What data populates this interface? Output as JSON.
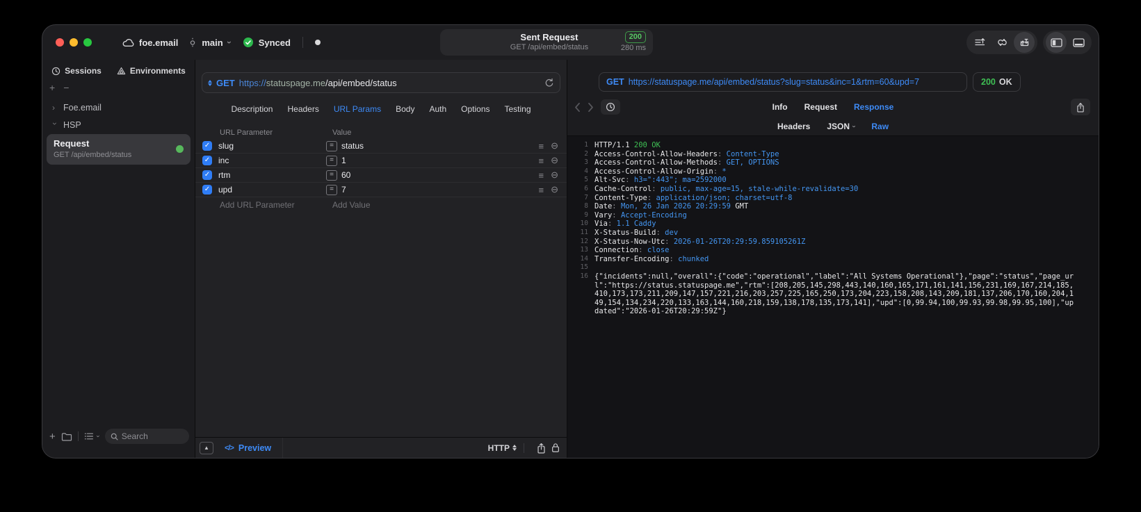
{
  "titlebar": {
    "project": "foe.email",
    "branch": "main",
    "sync_status": "Synced",
    "request_title": "Sent Request",
    "request_subtitle": "GET /api/embed/status",
    "status_code": "200",
    "duration": "280 ms"
  },
  "sidebar": {
    "tabs": [
      {
        "label": "Sessions"
      },
      {
        "label": "Environments"
      }
    ],
    "tree": [
      {
        "label": "Foe.email",
        "state": "collapsed"
      },
      {
        "label": "HSP",
        "state": "expanded"
      }
    ],
    "request_item": {
      "title": "Request",
      "subtitle": "GET /api/embed/status",
      "status_dot_color": "#57b85c"
    },
    "search_placeholder": "Search"
  },
  "editor": {
    "method": "GET",
    "url": {
      "scheme": "https://",
      "host": "statuspage.me",
      "path": "/api/embed/status"
    },
    "tabs": [
      "Description",
      "Headers",
      "URL Params",
      "Body",
      "Auth",
      "Options",
      "Testing"
    ],
    "active_tab": "URL Params",
    "params": {
      "columns": [
        "URL Parameter",
        "Value"
      ],
      "rows": [
        {
          "name": "slug",
          "value": "status",
          "enabled": true
        },
        {
          "name": "inc",
          "value": "1",
          "enabled": true
        },
        {
          "name": "rtm",
          "value": "60",
          "enabled": true
        },
        {
          "name": "upd",
          "value": "7",
          "enabled": true
        }
      ],
      "add_name_placeholder": "Add URL Parameter",
      "add_value_placeholder": "Add Value"
    },
    "footer": {
      "preview_label": "Preview",
      "protocol": "HTTP"
    }
  },
  "viewer": {
    "method": "GET",
    "url": "https://statuspage.me/api/embed/status?slug=status&inc=1&rtm=60&upd=7",
    "status_code": "200",
    "status_text": "OK",
    "tabs": [
      "Info",
      "Request",
      "Response"
    ],
    "active_tab": "Response",
    "subtabs": [
      "Headers",
      "JSON",
      "Raw"
    ],
    "active_subtab": "Raw",
    "colors": {
      "accent_blue": "#3e8bf7",
      "value_blue": "#4496f2",
      "success_green": "#3fbf54",
      "checkbox_blue": "#2f7df6"
    },
    "lines": [
      {
        "n": "1",
        "segs": [
          [
            "HTTP/1.1 ",
            "k"
          ],
          [
            "200 OK",
            "g"
          ]
        ]
      },
      {
        "n": "2",
        "segs": [
          [
            "Access-Control-Allow-Headers",
            "k"
          ],
          [
            ": ",
            "c"
          ],
          [
            "Content-Type",
            "v"
          ]
        ]
      },
      {
        "n": "3",
        "segs": [
          [
            "Access-Control-Allow-Methods",
            "k"
          ],
          [
            ": ",
            "c"
          ],
          [
            "GET, OPTIONS",
            "v"
          ]
        ]
      },
      {
        "n": "4",
        "segs": [
          [
            "Access-Control-Allow-Origin",
            "k"
          ],
          [
            ": ",
            "c"
          ],
          [
            "*",
            "v"
          ]
        ]
      },
      {
        "n": "5",
        "segs": [
          [
            "Alt-Svc",
            "k"
          ],
          [
            ": ",
            "c"
          ],
          [
            "h3=\":443\"; ma=2592000",
            "v"
          ]
        ]
      },
      {
        "n": "6",
        "segs": [
          [
            "Cache-Control",
            "k"
          ],
          [
            ": ",
            "c"
          ],
          [
            "public, max-age=15, stale-while-revalidate=30",
            "v"
          ]
        ]
      },
      {
        "n": "7",
        "segs": [
          [
            "Content-Type",
            "k"
          ],
          [
            ": ",
            "c"
          ],
          [
            "application/json; charset=utf-8",
            "v"
          ]
        ]
      },
      {
        "n": "8",
        "segs": [
          [
            "Date",
            "k"
          ],
          [
            ": ",
            "c"
          ],
          [
            "Mon, 26 Jan 2026 20:29:59",
            "v"
          ],
          [
            " GMT",
            "k"
          ]
        ]
      },
      {
        "n": "9",
        "segs": [
          [
            "Vary",
            "k"
          ],
          [
            ": ",
            "c"
          ],
          [
            "Accept-Encoding",
            "v"
          ]
        ]
      },
      {
        "n": "10",
        "segs": [
          [
            "Via",
            "k"
          ],
          [
            ": ",
            "c"
          ],
          [
            "1.1 Caddy",
            "v"
          ]
        ]
      },
      {
        "n": "11",
        "segs": [
          [
            "X-Status-Build",
            "k"
          ],
          [
            ": ",
            "c"
          ],
          [
            "dev",
            "v"
          ]
        ]
      },
      {
        "n": "12",
        "segs": [
          [
            "X-Status-Now-Utc",
            "k"
          ],
          [
            ": ",
            "c"
          ],
          [
            "2026-01-26T20:29:59.859105261Z",
            "v"
          ]
        ]
      },
      {
        "n": "13",
        "segs": [
          [
            "Connection",
            "k"
          ],
          [
            ": ",
            "c"
          ],
          [
            "close",
            "v"
          ]
        ]
      },
      {
        "n": "14",
        "segs": [
          [
            "Transfer-Encoding",
            "k"
          ],
          [
            ": ",
            "c"
          ],
          [
            "chunked",
            "v"
          ]
        ]
      },
      {
        "n": "15",
        "segs": []
      },
      {
        "n": "16",
        "segs": [
          [
            "{\"incidents\":null,\"overall\":{\"code\":\"operational\",\"label\":\"All Systems Operational\"},\"page\":\"status\",\"page_url\":\"https://status.statuspage.me\",\"rtm\":[208,205,145,298,443,140,160,165,171,161,141,156,231,169,167,214,185,410,173,173,211,209,147,157,221,216,203,257,225,165,250,173,204,223,158,208,143,209,181,137,206,170,160,204,149,154,134,234,220,133,163,144,160,218,159,138,178,135,173,141],\"upd\":[0,99.94,100,99.93,99.98,99.95,100],\"updated\":\"2026-01-26T20:29:59Z\"}",
            "k"
          ]
        ]
      }
    ]
  }
}
